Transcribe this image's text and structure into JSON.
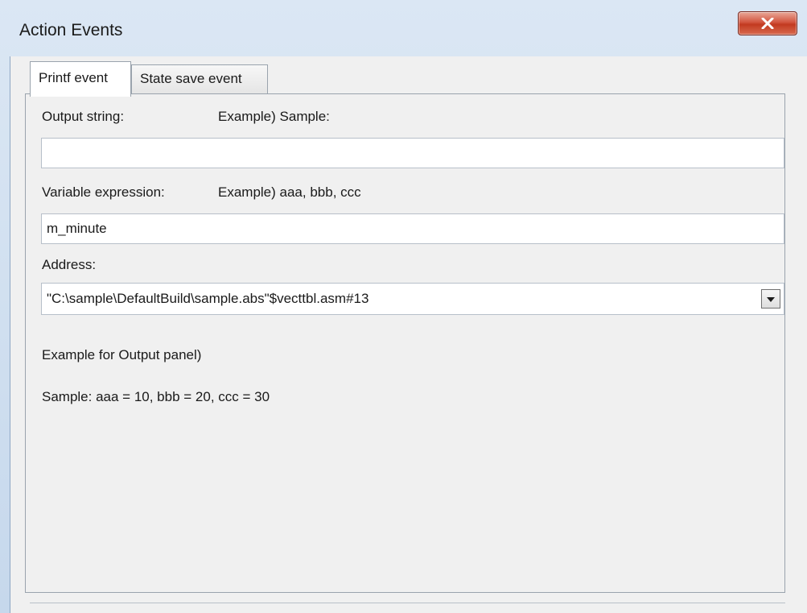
{
  "window": {
    "title": "Action Events"
  },
  "tabs": [
    {
      "label": "Printf event",
      "active": true
    },
    {
      "label": "State save event",
      "active": false
    }
  ],
  "form": {
    "output_string_label": "Output string:",
    "output_string_example": "Example) Sample:",
    "output_string_value": "",
    "variable_expression_label": "Variable expression:",
    "variable_expression_example": "Example) aaa, bbb, ccc",
    "variable_expression_value": "m_minute",
    "address_label": "Address:",
    "address_value": "\"C:\\sample\\DefaultBuild\\sample.abs\"$vecttbl.asm#13",
    "output_panel_example_label": "Example for Output panel)",
    "output_panel_example_text": "Sample: aaa = 10, bbb = 20, ccc = 30"
  },
  "icons": {
    "close": "close-icon",
    "dropdown": "chevron-down-icon"
  },
  "colors": {
    "close_button": "#c8452b",
    "title_bar": "#cfdff0",
    "panel": "#f0f0f0"
  }
}
